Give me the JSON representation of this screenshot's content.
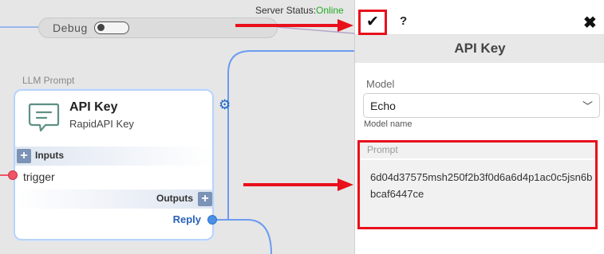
{
  "server_status": {
    "label": "Server Status:",
    "value": "Online"
  },
  "debug": {
    "label": "Debug",
    "enabled": false
  },
  "node": {
    "category": "LLM Prompt",
    "name": "API Key",
    "subtitle": "RapidAPI Key",
    "inputs_label": "Inputs",
    "input_ports": [
      "trigger"
    ],
    "outputs_label": "Outputs",
    "output_ports": [
      "Reply"
    ],
    "icon": "chat-icon"
  },
  "panel": {
    "toolbar": {
      "confirm_icon": "✔",
      "help_icon": "?",
      "close_icon": "✖"
    },
    "title": "API Key",
    "model": {
      "label": "Model",
      "value": "Echo",
      "help": "Model name"
    },
    "prompt": {
      "label": "Prompt",
      "value": "6d04d37575msh250f2b3f0d6a6d4p1ac0c5jsn6bbcaf6447ce"
    }
  },
  "colors": {
    "annotation": "#e8101b",
    "edge": "#6a9cf0",
    "online": "#22aa22",
    "reply": "#2a62b8"
  }
}
